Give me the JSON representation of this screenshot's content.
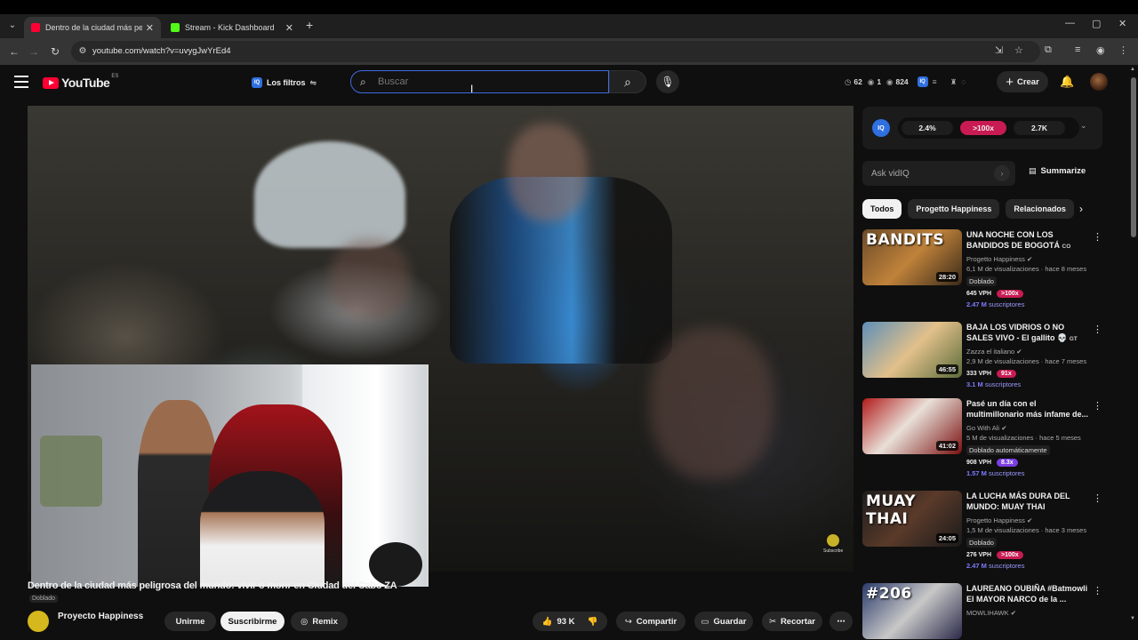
{
  "browser": {
    "tabs": [
      {
        "title": "Dentro de la ciudad más peligrosa",
        "favicon_color": "#ff0033",
        "active": true
      },
      {
        "title": "Stream - Kick Dashboard",
        "favicon_color": "#53fc18",
        "active": false
      }
    ],
    "url": "youtube.com/watch?v=uvygJwYrEd4"
  },
  "header": {
    "logo_text": "YouTube",
    "country": "ES",
    "filters_label": "Los filtros",
    "search_placeholder": "Buscar",
    "stats": {
      "a": "62",
      "b": "1",
      "c": "824"
    },
    "create_label": "Crear"
  },
  "video": {
    "title": "Dentro de la ciudad más peligrosa del mundo: vivir o morir en Ciudad del Cabo ZA",
    "dubbed_label": "Doblado",
    "watermark_label": "Subscribe",
    "channel_name": "Proyecto Happiness",
    "join_label": "Unirme",
    "subscribe_label": "Suscribirme",
    "remix_label": "Remix",
    "likes": "93 K",
    "share_label": "Compartir",
    "save_label": "Guardar",
    "clip_label": "Recortar"
  },
  "vidiq": {
    "metric1": "2.4%",
    "metric2": ">100x",
    "metric3": "2.7K",
    "ask_placeholder": "Ask vidIQ",
    "summarize_label": "Summarize"
  },
  "chips": [
    "Todos",
    "Progetto Happiness",
    "Relacionados"
  ],
  "recommendations": [
    {
      "thumb_text": "BANDITS",
      "thumb_bg": "linear-gradient(135deg,#6b4a2a,#c0823a 50%,#3a2a1a)",
      "duration": "28:20",
      "title": "UNA NOCHE CON LOS BANDIDOS DE BOGOTÁ",
      "flag": "CO",
      "channel": "Progetto Happiness",
      "stats": "6,1 M de visualizaciones · hace 8 meses",
      "dub": "Doblado",
      "vph": "645 VPH",
      "mult": ">100x",
      "mult_color": "#c81b53",
      "subs_value": "2.47 M",
      "subs_word": "suscriptores"
    },
    {
      "thumb_text": "",
      "thumb_bg": "linear-gradient(135deg,#5d8fb8,#e2c08a 50%,#5a6b3a)",
      "duration": "46:55",
      "title": "BAJA LOS VIDRIOS O NO SALES VIVO - El gallito 💀",
      "flag": "GT",
      "channel": "Zazza el italiano",
      "stats": "2,9 M de visualizaciones · hace 7 meses",
      "dub": "",
      "vph": "333 VPH",
      "mult": "91x",
      "mult_color": "#c81b53",
      "subs_value": "3.1 M",
      "subs_word": "suscriptores"
    },
    {
      "thumb_text": "",
      "thumb_bg": "linear-gradient(135deg,#b11a1a,#e8e0d8 45%,#7a1010)",
      "duration": "41:02",
      "title": "Pasé un día con el multimillonario más infame de...",
      "flag": "",
      "channel": "Go With Ali",
      "stats": "5 M de visualizaciones · hace 5 meses",
      "dub": "Doblado automáticamente",
      "vph": "908 VPH",
      "mult": "8.3x",
      "mult_color": "#7b3fe4",
      "subs_value": "1.57 M",
      "subs_word": "suscriptores"
    },
    {
      "thumb_text": "MUAY THAI",
      "thumb_bg": "linear-gradient(135deg,#1c1c1c,#5a3a2a 50%,#1a1a1a)",
      "duration": "24:05",
      "title": "LA LUCHA MÁS DURA DEL MUNDO: MUAY THAI",
      "flag": "",
      "channel": "Progetto Happiness",
      "stats": "1,5 M de visualizaciones · hace 3 meses",
      "dub": "Doblado",
      "vph": "276 VPH",
      "mult": ">100x",
      "mult_color": "#c81b53",
      "subs_value": "2.47 M",
      "subs_word": "suscriptores"
    },
    {
      "thumb_text": "#206",
      "thumb_bg": "linear-gradient(135deg,#2a3a6a,#c8c8c8 50%,#2a2a4a)",
      "duration": "",
      "title": "LAUREANO OUBIÑA #Batmowli El MAYOR NARCO de la ...",
      "flag": "",
      "channel": "MOWLIHAWK",
      "stats": "",
      "dub": "",
      "vph": "",
      "mult": "",
      "mult_color": "#c81b53",
      "subs_value": "",
      "subs_word": ""
    }
  ]
}
